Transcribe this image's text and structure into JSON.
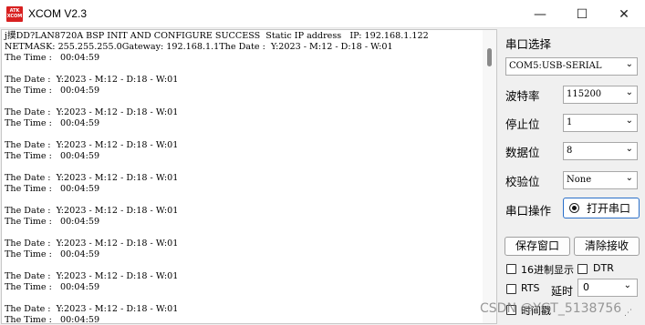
{
  "window": {
    "title": "XCOM V2.3",
    "logo_top": "ATK",
    "logo_bottom": "XCOM",
    "min_glyph": "—",
    "max_glyph": "☐",
    "close_glyph": "✕"
  },
  "console": {
    "text": "j摸DD?LAN8720A BSP INIT AND CONFIGURE SUCCESS  Static IP address   IP: 192.168.1.122\nNETMASK: 255.255.255.0Gateway: 192.168.1.1The Date :  Y:2023 - M:12 - D:18 - W:01\nThe Time :   00:04:59\n\nThe Date :  Y:2023 - M:12 - D:18 - W:01\nThe Time :   00:04:59\n\nThe Date :  Y:2023 - M:12 - D:18 - W:01\nThe Time :   00:04:59\n\nThe Date :  Y:2023 - M:12 - D:18 - W:01\nThe Time :   00:04:59\n\nThe Date :  Y:2023 - M:12 - D:18 - W:01\nThe Time :   00:04:59\n\nThe Date :  Y:2023 - M:12 - D:18 - W:01\nThe Time :   00:04:59\n\nThe Date :  Y:2023 - M:12 - D:18 - W:01\nThe Time :   00:04:59\n\nThe Date :  Y:2023 - M:12 - D:18 - W:01\nThe Time :   00:04:59\n\nThe Date :  Y:2023 - M:12 - D:18 - W:01\nThe Time :   00:04:59"
  },
  "panel": {
    "port_select_label": "串口选择",
    "port_value": "COM5:USB-SERIAL",
    "baud_label": "波特率",
    "baud_value": "115200",
    "stopbits_label": "停止位",
    "stopbits_value": "1",
    "databits_label": "数据位",
    "databits_value": "8",
    "parity_label": "校验位",
    "parity_value": "None",
    "port_op_label": "串口操作",
    "open_port_button": "打开串口",
    "save_window_button": "保存窗口",
    "clear_receive_button": "清除接收",
    "hex_display_label": "16进制显示",
    "dtr_label": "DTR",
    "rts_label": "RTS",
    "delay_label": "延时",
    "delay_value": "0",
    "timestamp_label": "时间戳"
  },
  "watermark": "CSDN @YGT_5138756",
  "colors": {
    "accent": "#2a6fc9",
    "logo_red": "#d82020"
  }
}
